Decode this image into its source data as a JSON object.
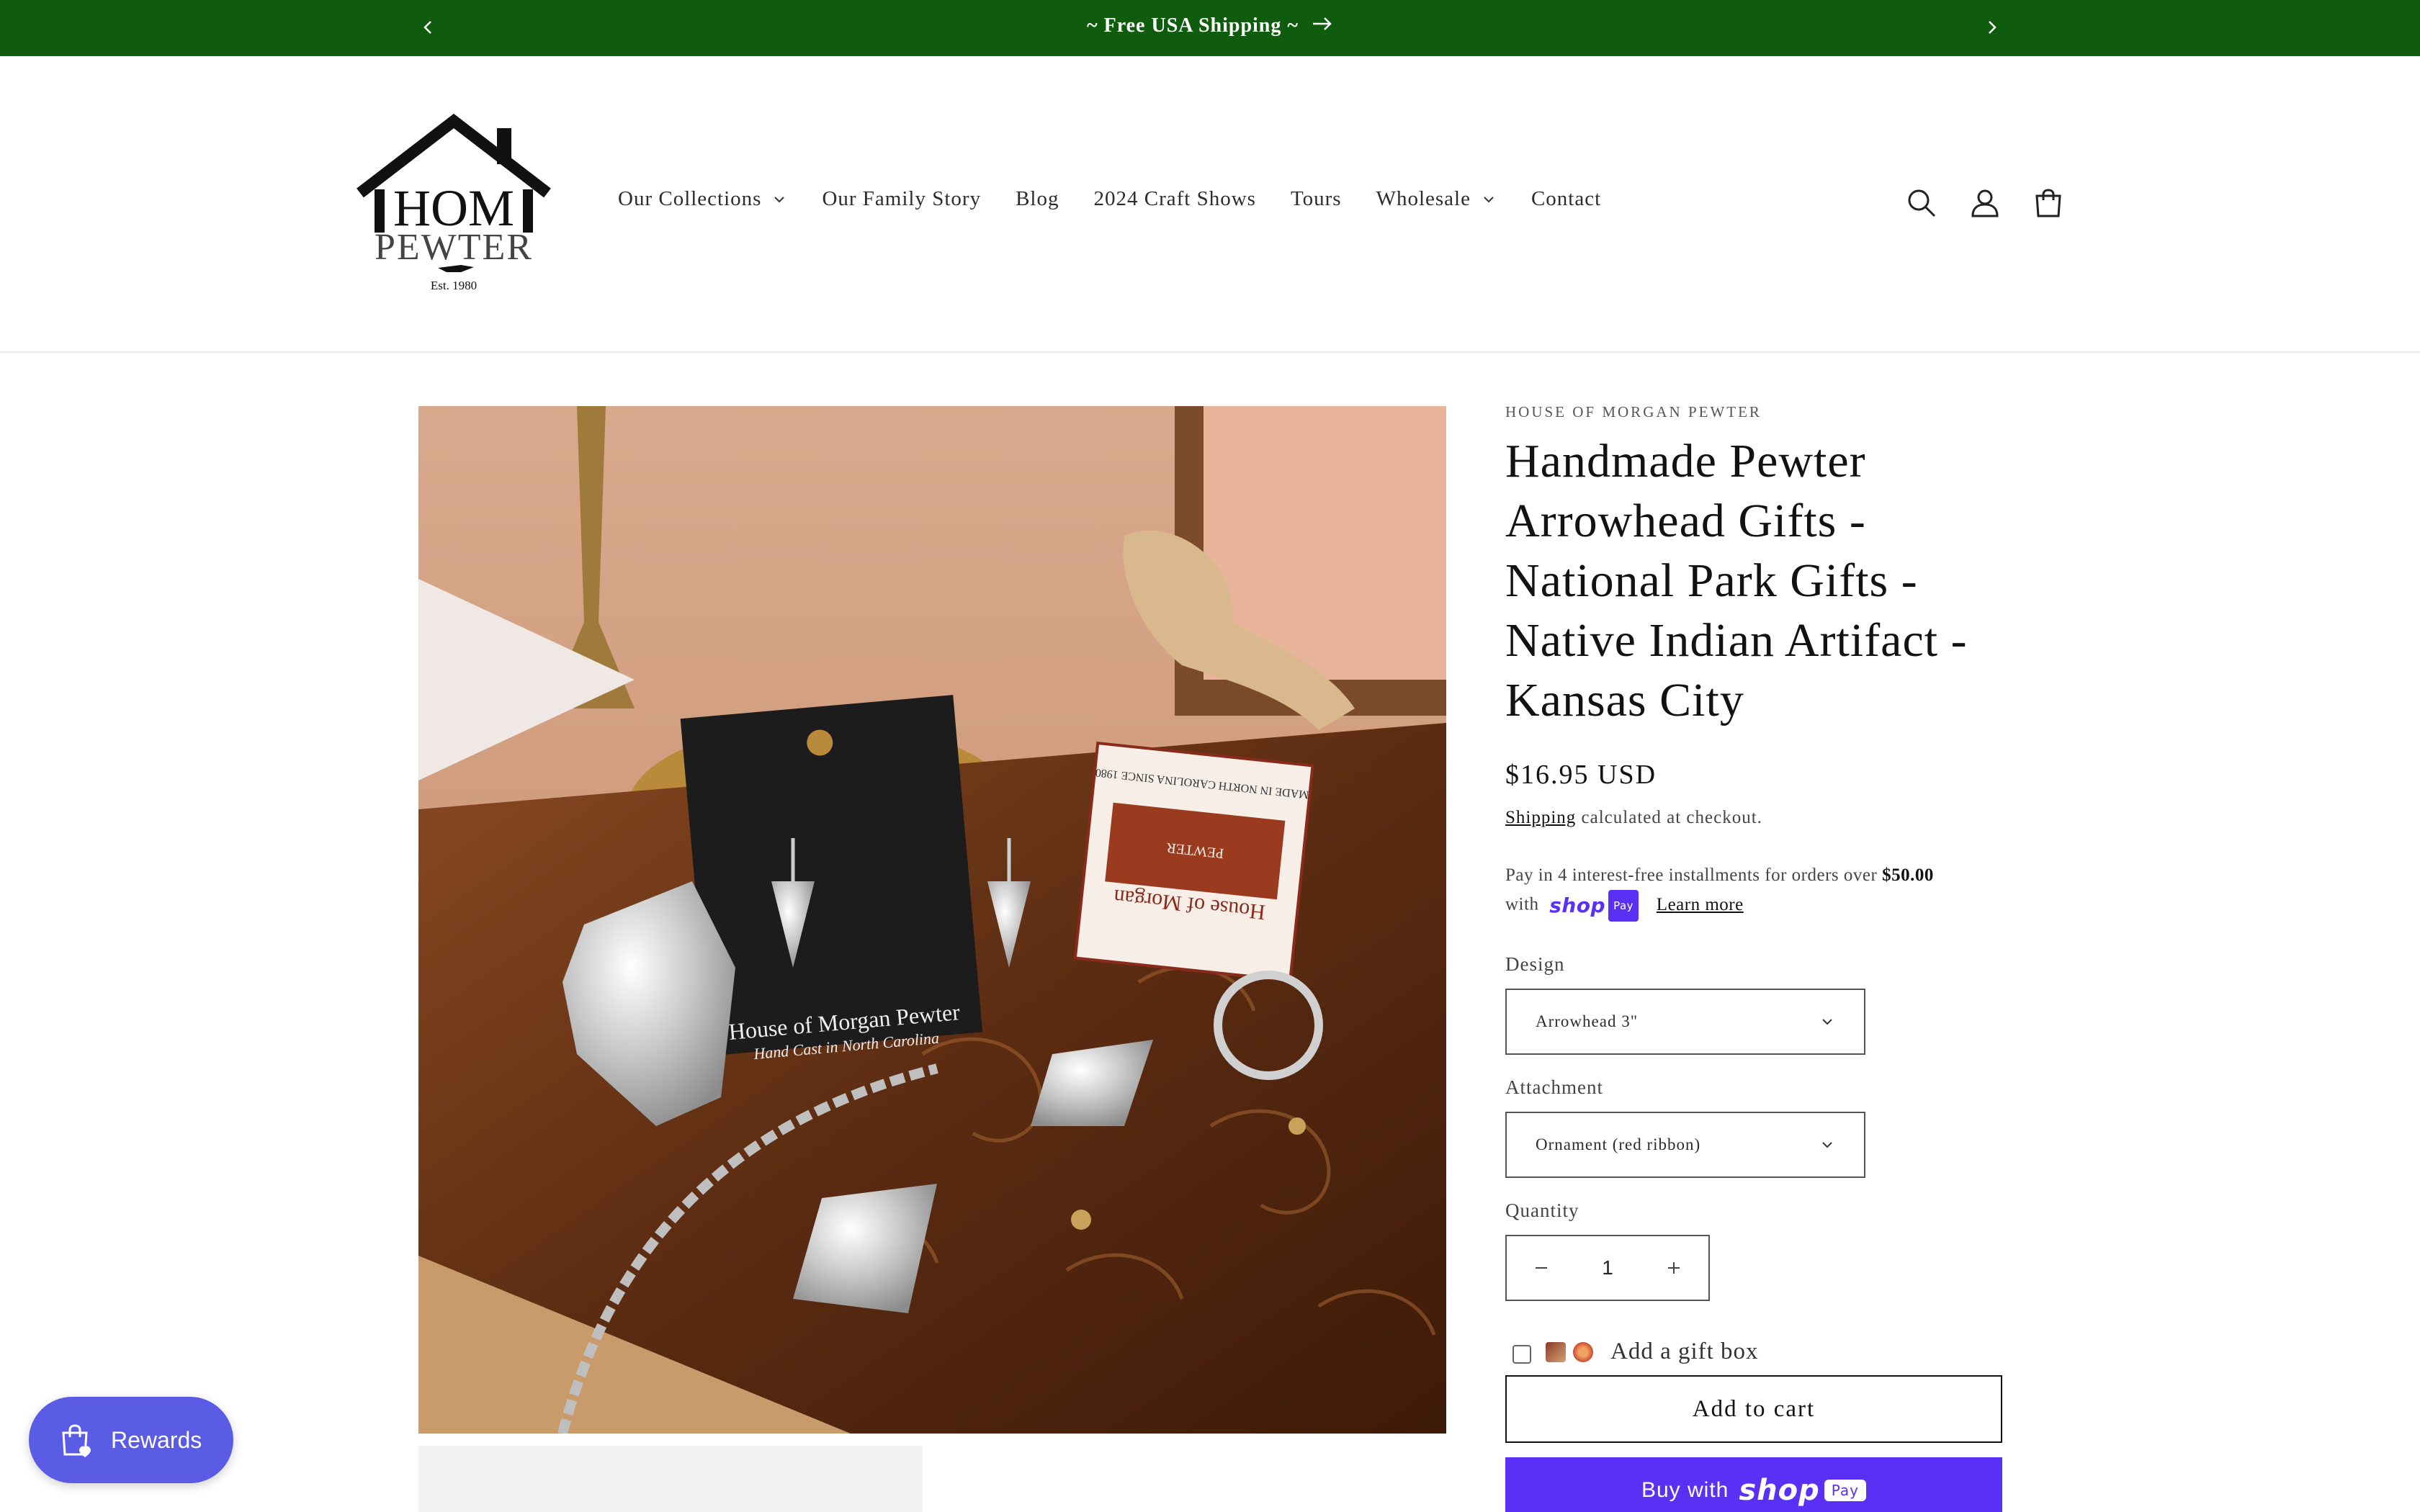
{
  "announcement": {
    "message": "~ Free USA Shipping ~",
    "bg_color": "#0f5c0f"
  },
  "header": {
    "logo": {
      "line1": "HOM",
      "line2": "PEWTER",
      "line3": "Est. 1980"
    },
    "nav": [
      {
        "label": "Our Collections",
        "has_dropdown": true
      },
      {
        "label": "Our Family Story",
        "has_dropdown": false
      },
      {
        "label": "Blog",
        "has_dropdown": false
      },
      {
        "label": "2024 Craft Shows",
        "has_dropdown": false
      },
      {
        "label": "Tours",
        "has_dropdown": false
      },
      {
        "label": "Wholesale",
        "has_dropdown": true
      },
      {
        "label": "Contact",
        "has_dropdown": false
      }
    ],
    "icons": [
      "search-icon",
      "account-icon",
      "cart-icon"
    ]
  },
  "product": {
    "vendor": "HOUSE OF MORGAN PEWTER",
    "title_lines": [
      "Handmade Pewter",
      "Arrowhead Gifts -",
      "National Park Gifts -",
      "Native Indian Artifact -",
      "Kansas City"
    ],
    "price": "$16.95 USD",
    "shipping_link": "Shipping",
    "shipping_note": "calculated at checkout.",
    "installments_prefix": "Pay in 4 interest-free installments for orders over",
    "installments_amount": "$50.00",
    "installments_with": "with",
    "shop_word": "shop",
    "pay_badge": "Pay",
    "learn_more": "Learn more",
    "image_card_text": "House of Morgan Pewter",
    "image_card_subtext": "Hand Cast in North Carolina",
    "image_label_text": "House of Morgan",
    "image_label_small": "PEWTER",
    "image_label_top": "MADE IN NORTH CAROLINA SINCE 1980"
  },
  "options": {
    "design_label": "Design",
    "design_value": "Arrowhead 3\"",
    "attachment_label": "Attachment",
    "attachment_value": "Ornament (red ribbon)",
    "quantity_label": "Quantity",
    "quantity_value": "1"
  },
  "actions": {
    "gift_box_label": "Add a gift box",
    "add_to_cart": "Add to cart",
    "buy_with": "Buy with",
    "buy_shop": "shop",
    "buy_pay": "Pay",
    "accent_color": "#5a31f4"
  },
  "rewards": {
    "label": "Rewards",
    "color": "#5b5ce6"
  }
}
